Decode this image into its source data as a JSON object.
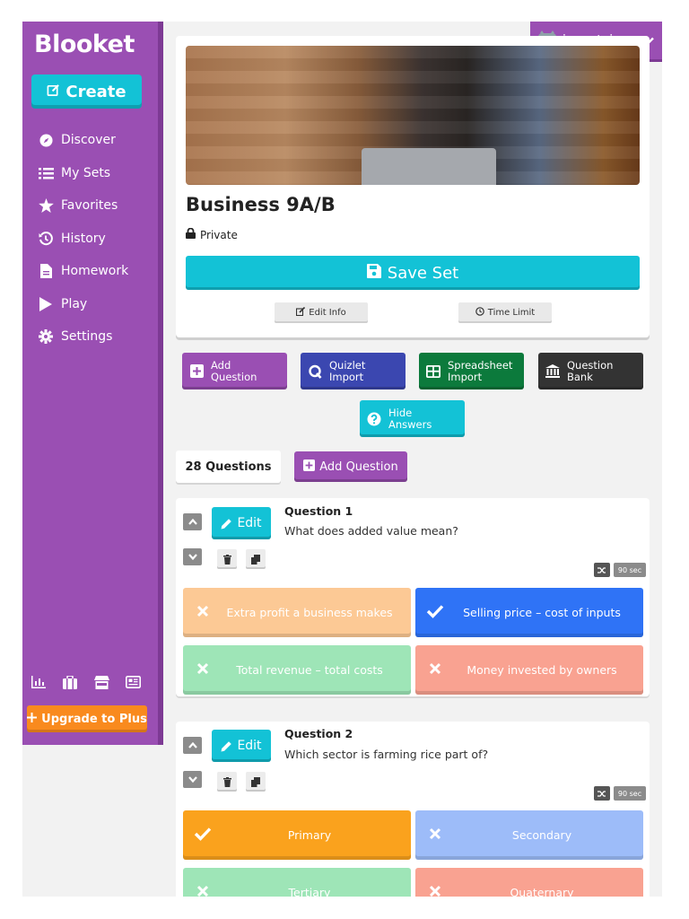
{
  "brand": {
    "logo": "Blooket"
  },
  "sidebar": {
    "create_label": "Create",
    "items": [
      {
        "label": "Discover",
        "icon": "compass-icon"
      },
      {
        "label": "My Sets",
        "icon": "list-icon"
      },
      {
        "label": "Favorites",
        "icon": "star-icon"
      },
      {
        "label": "History",
        "icon": "history-icon"
      },
      {
        "label": "Homework",
        "icon": "document-icon"
      },
      {
        "label": "Play",
        "icon": "play-icon"
      },
      {
        "label": "Settings",
        "icon": "gear-icon"
      }
    ],
    "bottom_icons": [
      "stats-icon",
      "blooks-icon",
      "market-icon",
      "news-icon"
    ],
    "upgrade_label": "Upgrade to Plus"
  },
  "account": {
    "username": "ivanatejo"
  },
  "set": {
    "title": "Business 9A/B",
    "privacy": "Private",
    "save_label": "Save Set",
    "edit_info_label": "Edit Info",
    "time_limit_label": "Time Limit"
  },
  "actions": {
    "add_question": "Add Question",
    "quizlet_import": "Quizlet Import",
    "spreadsheet_import": "Spreadsheet Import",
    "question_bank": "Question Bank",
    "hide_answers": "Hide Answers"
  },
  "questions_header": {
    "count_label": "28 Questions",
    "add_question_label": "Add Question"
  },
  "questions": [
    {
      "number_label": "Question 1",
      "text": "What does added value mean?",
      "edit_label": "Edit",
      "time_label": "90 sec",
      "answers": [
        {
          "text": "Extra profit a business makes",
          "correct": false,
          "color": "#fcc995"
        },
        {
          "text": "Selling price – cost of inputs",
          "correct": true,
          "color": "#2f73f6"
        },
        {
          "text": "Total revenue – total costs",
          "correct": false,
          "color": "#9ee5b7"
        },
        {
          "text": "Money invested by owners",
          "correct": false,
          "color": "#f9a291"
        }
      ]
    },
    {
      "number_label": "Question 2",
      "text": "Which sector is farming rice part of?",
      "edit_label": "Edit",
      "time_label": "90 sec",
      "answers": [
        {
          "text": "Primary",
          "correct": true,
          "color": "#faa21d"
        },
        {
          "text": "Secondary",
          "correct": false,
          "color": "#9dbcf9"
        },
        {
          "text": "Tertiary",
          "correct": false,
          "color": "#9ee5b7"
        },
        {
          "text": "Quaternary",
          "correct": false,
          "color": "#f9a291"
        }
      ]
    }
  ],
  "colors": {
    "sidebar": "#9a4fb3",
    "accent_cyan": "#13c2d6",
    "upgrade_orange": "#f98a1e",
    "quizlet_blue": "#3b47b0",
    "spreadsheet_green": "#0c7a3c",
    "question_bank_dark": "#333333"
  }
}
